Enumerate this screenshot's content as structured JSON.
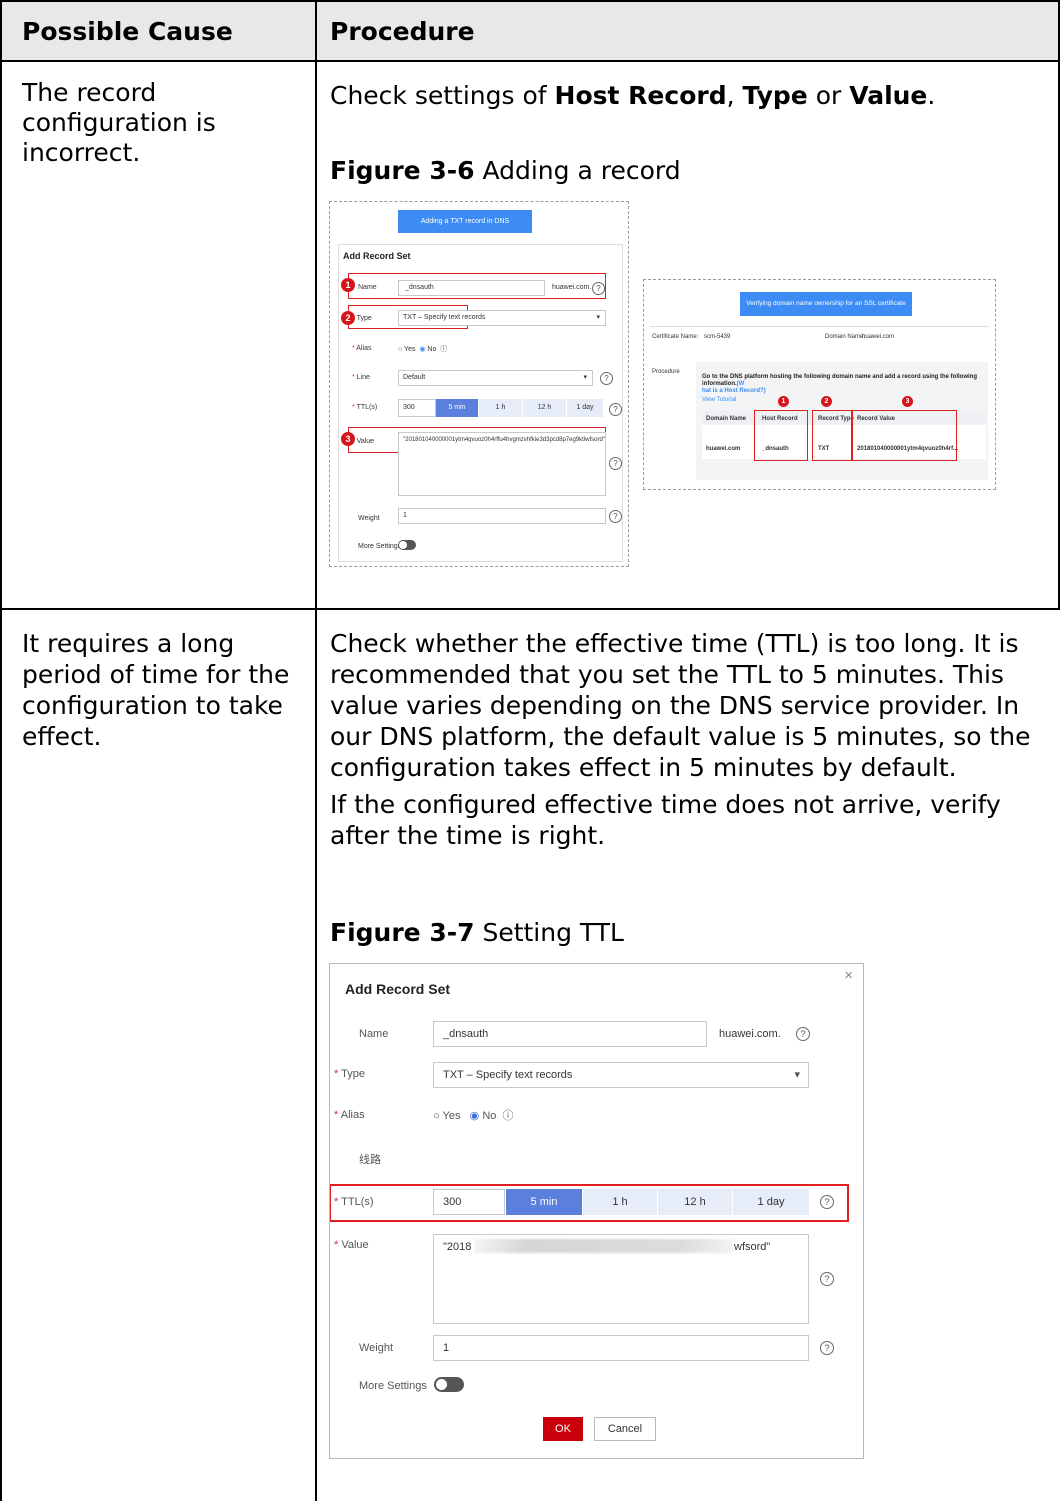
{
  "table": {
    "header": {
      "col1": "Possible Cause",
      "col2": "Procedure"
    },
    "rows": [
      {
        "cause": "The record configuration is incorrect.",
        "proc_prefix": "Check settings of ",
        "proc_b1": "Host Record",
        "proc_sep1": ", ",
        "proc_b2": "Type",
        "proc_sep2": " or ",
        "proc_b3": "Value",
        "proc_end": ".",
        "figure_num": "Figure 3-6",
        "figure_title": "Adding a record"
      },
      {
        "cause": "It requires a long period of time for the configuration to take effect.",
        "para1": "Check whether the effective time (TTL) is too long. It is recommended that you set the TTL to 5 minutes. This value varies depending on the DNS service provider. In our DNS platform, the default value is 5 minutes, so the configuration takes effect in 5 minutes by default.",
        "para2": "If the configured effective time does not arrive, verify after the time is right.",
        "figure_num": "Figure 3-7",
        "figure_title": "Setting TTL"
      }
    ]
  },
  "fig1": {
    "left": {
      "banner": "Adding a TXT record in DNS",
      "title": "Add Record Set",
      "name_label": "Name",
      "name_value": "_dnsauth",
      "domain_suffix": "huawei.com.",
      "type_label": "Type",
      "type_value": "TXT – Specify text records",
      "alias_label": "Alias",
      "alias_yes": "Yes",
      "alias_no": "No",
      "line_label": "Line",
      "line_value": "Default",
      "ttl_label": "TTL(s)",
      "ttl_value": "300",
      "ttl_opts": [
        "5 min",
        "1 h",
        "12 h",
        "1 day"
      ],
      "value_label": "Value",
      "value_text": "\"201801040000001ytm4qvuoz0h4rffu4hvgmzvhfkie3d3pcd8p7eg9ktlwfsord\"",
      "weight_label": "Weight",
      "weight_value": "1",
      "more_label": "More Settings",
      "badges": [
        "1",
        "2",
        "3"
      ]
    },
    "right": {
      "banner": "Verifying domain name ownership for an SSL certificate",
      "cert_label": "Certificate Name:",
      "cert_value": "scm-5439",
      "domain_label": "Domain Name:",
      "domain_value": "huawei.com",
      "procedure_label": "Procedure",
      "instruction": "Go to the DNS platform hosting the following domain name and add a record using the following information.",
      "link1": "(W",
      "link2": "hat is a Host Record?)",
      "tutorial": "View Tutorial",
      "cols": [
        "Domain Name",
        "Host Record",
        "Record Type",
        "Record Value"
      ],
      "row": [
        "huawei.com",
        "_dnsauth",
        "TXT",
        "201801040000001ytm4qvuoz0h4rf..."
      ],
      "badges": [
        "1",
        "2",
        "3"
      ]
    }
  },
  "fig2": {
    "title": "Add Record Set",
    "close": "×",
    "name_label": "Name",
    "name_value": "_dnsauth",
    "domain_suffix": "huawei.com.",
    "type_label": "Type",
    "type_value": "TXT – Specify text records",
    "alias_label": "Alias",
    "alias_yes": "Yes",
    "alias_no": "No",
    "line_label": "线路",
    "ttl_label": "TTL(s)",
    "ttl_value": "300",
    "ttl_opts": [
      "5 min",
      "1 h",
      "12 h",
      "1 day"
    ],
    "value_label": "Value",
    "value_start": "\"2018",
    "value_end": "wfsord\"",
    "weight_label": "Weight",
    "weight_value": "1",
    "more_label": "More Settings",
    "ok": "OK",
    "cancel": "Cancel"
  }
}
